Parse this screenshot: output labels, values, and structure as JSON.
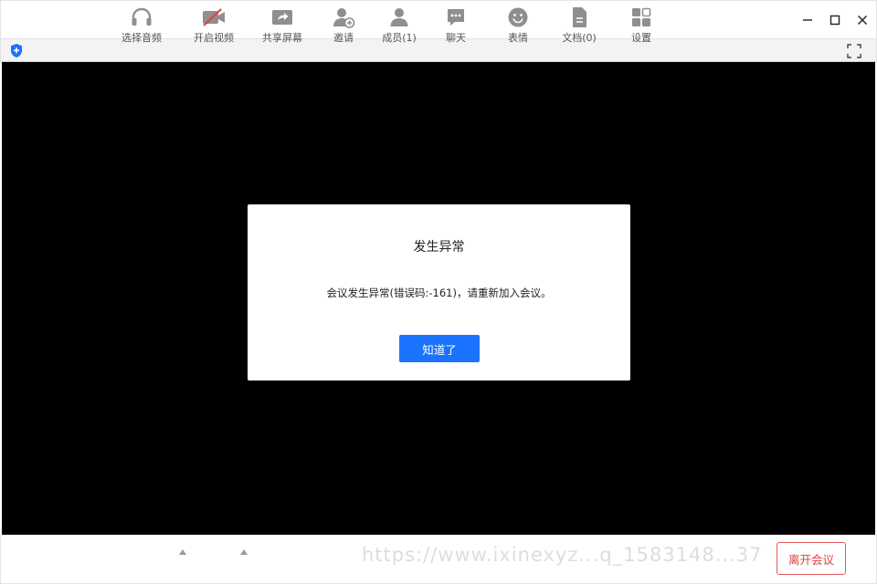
{
  "dialog": {
    "title": "发生异常",
    "message": "会议发生异常(错误码:-161)，请重新加入会议。",
    "confirm_label": "知道了"
  },
  "toolbar": {
    "audio_label": "选择音频",
    "video_label": "开启视频",
    "share_label": "共享屏幕",
    "invite_label": "邀请",
    "members_label": "成员(1)",
    "chat_label": "聊天",
    "emoji_label": "表情",
    "docs_label": "文档(0)",
    "settings_label": "设置",
    "leave_label": "离开会议"
  },
  "watermark": "https://www.ixinexyz...q_1583148...37",
  "colors": {
    "primary": "#1a73ff",
    "danger": "#e04040",
    "video_bg": "#000000",
    "icon_gray": "#8f8f8f"
  }
}
